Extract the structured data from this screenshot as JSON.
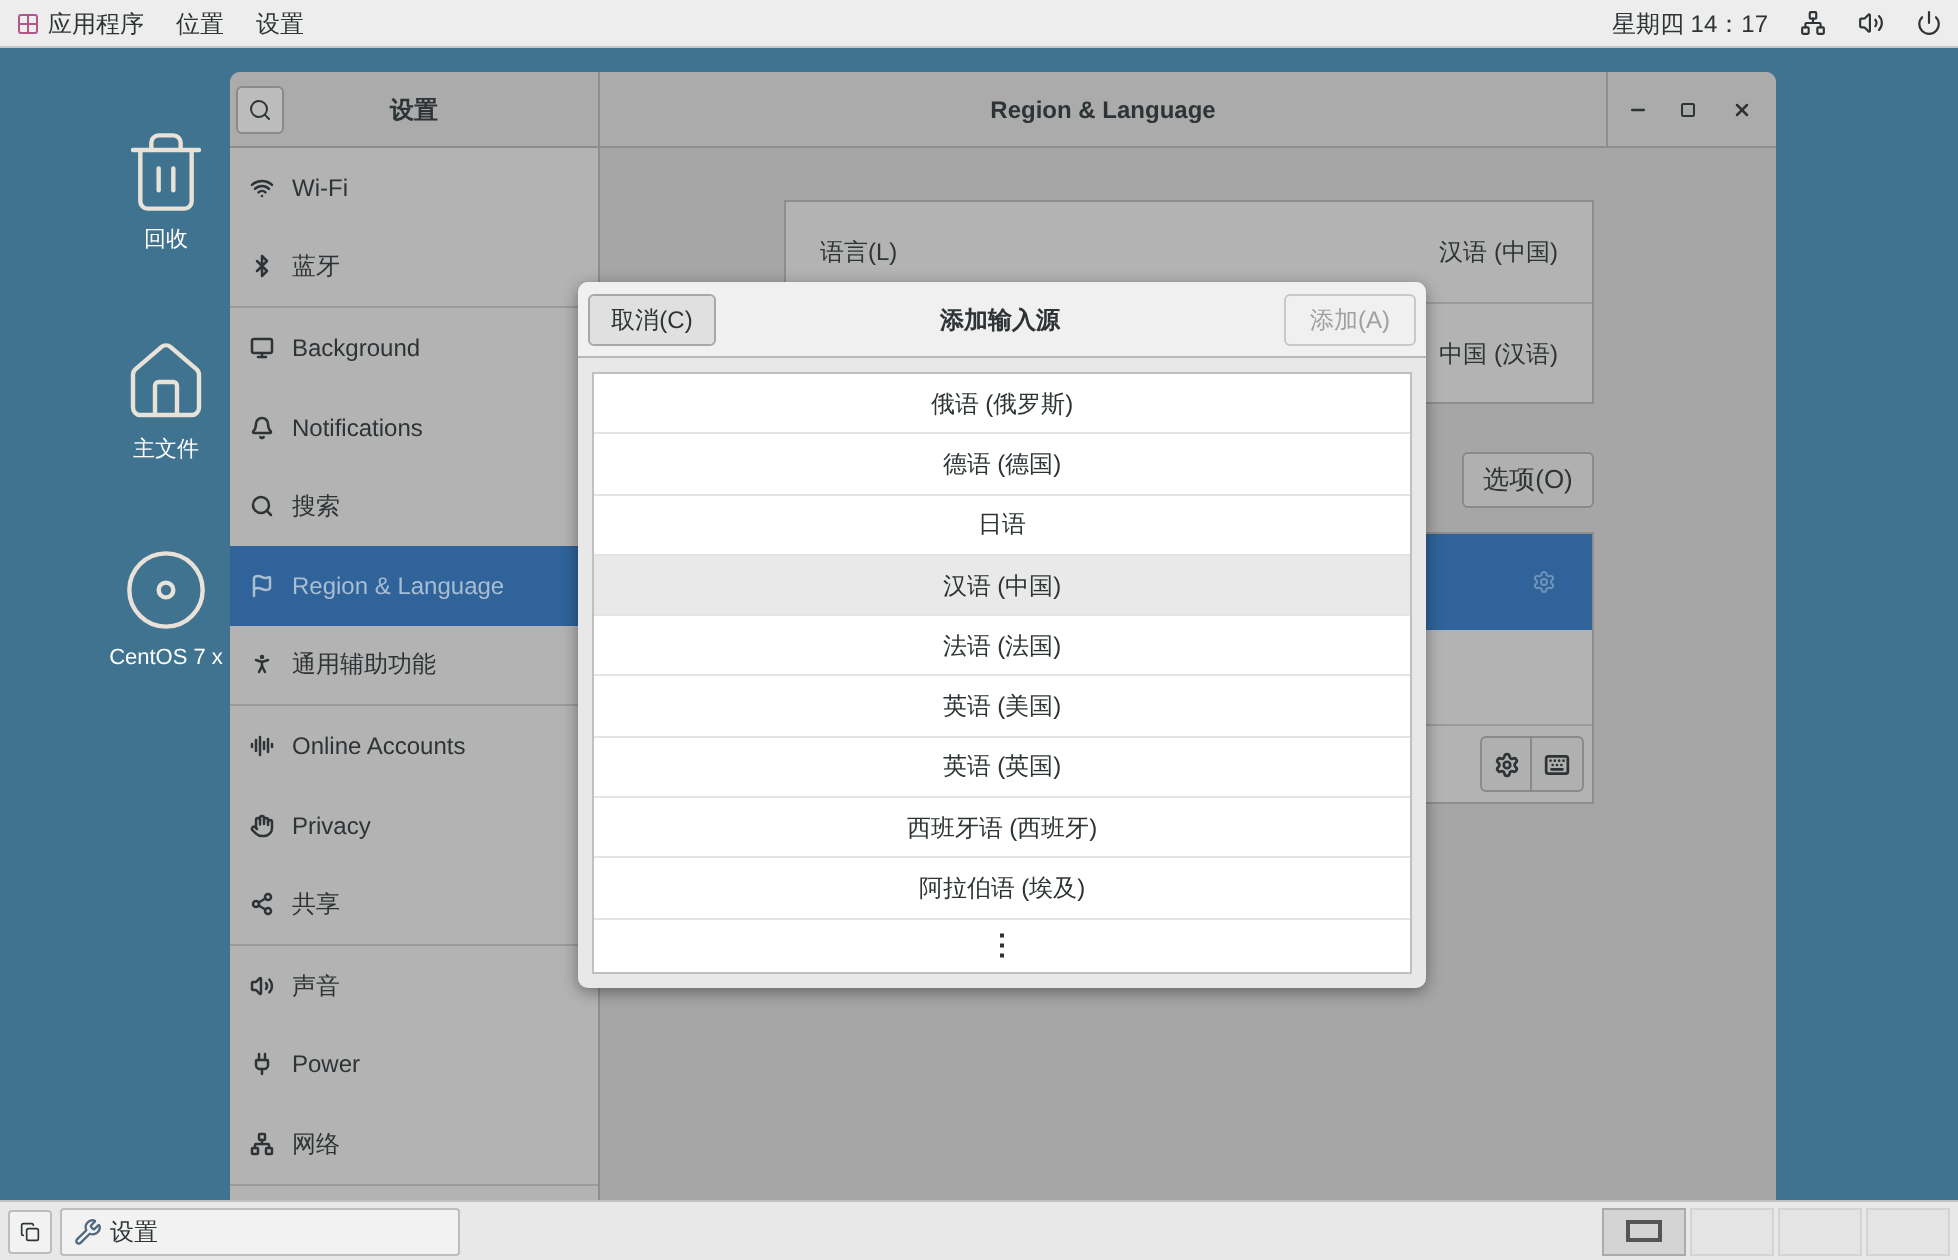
{
  "top_bar": {
    "menus": [
      "应用程序",
      "位置",
      "设置"
    ],
    "clock": "星期四 14：17"
  },
  "desktop_icons": [
    {
      "kind": "trash",
      "label": "回收"
    },
    {
      "kind": "home",
      "label": "主文件"
    },
    {
      "kind": "disc",
      "label": "CentOS 7 x"
    }
  ],
  "settings_window": {
    "sidebar_title": "设置",
    "panel_title": "Region & Language",
    "sidebar_groups": [
      {
        "items": [
          {
            "label": "Wi-Fi",
            "selected": false
          },
          {
            "label": "蓝牙",
            "selected": false
          }
        ]
      },
      {
        "items": [
          {
            "label": "Background",
            "selected": false
          },
          {
            "label": "Notifications",
            "selected": false
          },
          {
            "label": "搜索",
            "selected": false
          },
          {
            "label": "Region & Language",
            "selected": true
          },
          {
            "label": "通用辅助功能",
            "selected": false
          }
        ]
      },
      {
        "items": [
          {
            "label": "Online Accounts",
            "selected": false
          },
          {
            "label": "Privacy",
            "selected": false
          },
          {
            "label": "共享",
            "selected": false
          }
        ]
      },
      {
        "items": [
          {
            "label": "声音",
            "selected": false
          },
          {
            "label": "Power",
            "selected": false
          },
          {
            "label": "网络",
            "selected": false
          }
        ]
      }
    ],
    "language_rows": [
      {
        "label": "语言(L)",
        "value": "汉语 (中国)"
      },
      {
        "value": "中国 (汉语)"
      }
    ],
    "options_button": "选项(O)",
    "input_sources": [
      {
        "selected": true,
        "kind": "configurable"
      },
      {
        "selected": false,
        "kind": "plain"
      }
    ]
  },
  "dialog": {
    "cancel": "取消(C)",
    "title": "添加输入源",
    "add": {
      "label": "添加(A)",
      "disabled": true
    },
    "languages": [
      {
        "label": "俄语 (俄罗斯)",
        "selected": false
      },
      {
        "label": "德语 (德国)",
        "selected": false
      },
      {
        "label": "日语",
        "selected": false
      },
      {
        "label": "汉语 (中国)",
        "selected": true
      },
      {
        "label": "法语 (法国)",
        "selected": false
      },
      {
        "label": "英语 (美国)",
        "selected": false
      },
      {
        "label": "英语 (英国)",
        "selected": false
      },
      {
        "label": "西班牙语 (西班牙)",
        "selected": false
      },
      {
        "label": "阿拉伯语 (埃及)",
        "selected": false
      }
    ],
    "more": "⋮"
  },
  "taskbar": {
    "tasks": [
      {
        "label": "设置"
      }
    ],
    "workspaces": [
      {
        "selected": true
      },
      {
        "selected": false
      },
      {
        "selected": false
      },
      {
        "selected": false
      }
    ]
  }
}
